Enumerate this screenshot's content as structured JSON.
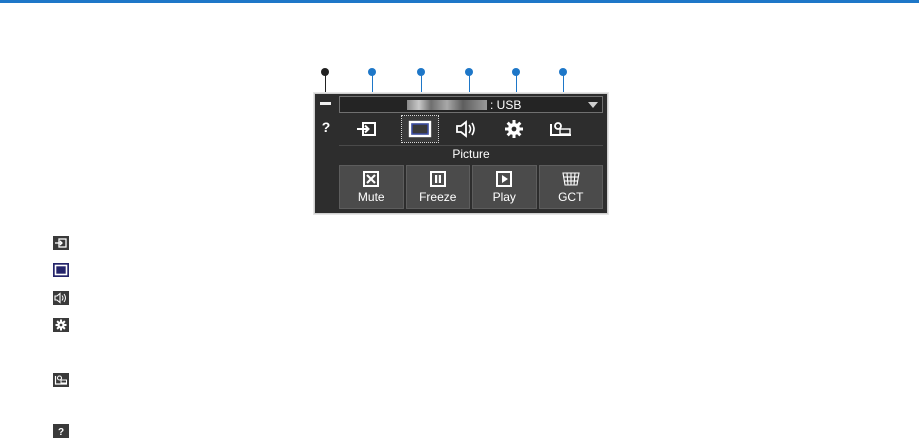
{
  "colors": {
    "accent": "#1e77c8",
    "panel_bg": "#2d2d2d",
    "button_bg": "#4b4b4b",
    "text": "#ffffff"
  },
  "panel": {
    "source_value": ": USB",
    "help_label": "?",
    "toolbar_icons": [
      "input-icon",
      "picture-icon",
      "sound-icon",
      "settings-gear-icon",
      "projector-info-icon"
    ],
    "selected_tool": "picture-icon",
    "mode_title": "Picture",
    "buttons": [
      {
        "label": "Mute",
        "icon": "mute-icon"
      },
      {
        "label": "Freeze",
        "icon": "freeze-icon"
      },
      {
        "label": "Play",
        "icon": "play-icon"
      },
      {
        "label": "GCT",
        "icon": "gct-icon"
      }
    ]
  },
  "legend": {
    "icons": [
      "input-icon",
      "picture-icon",
      "sound-icon",
      "settings-gear-icon",
      "projector-info-icon",
      "help-icon"
    ]
  }
}
